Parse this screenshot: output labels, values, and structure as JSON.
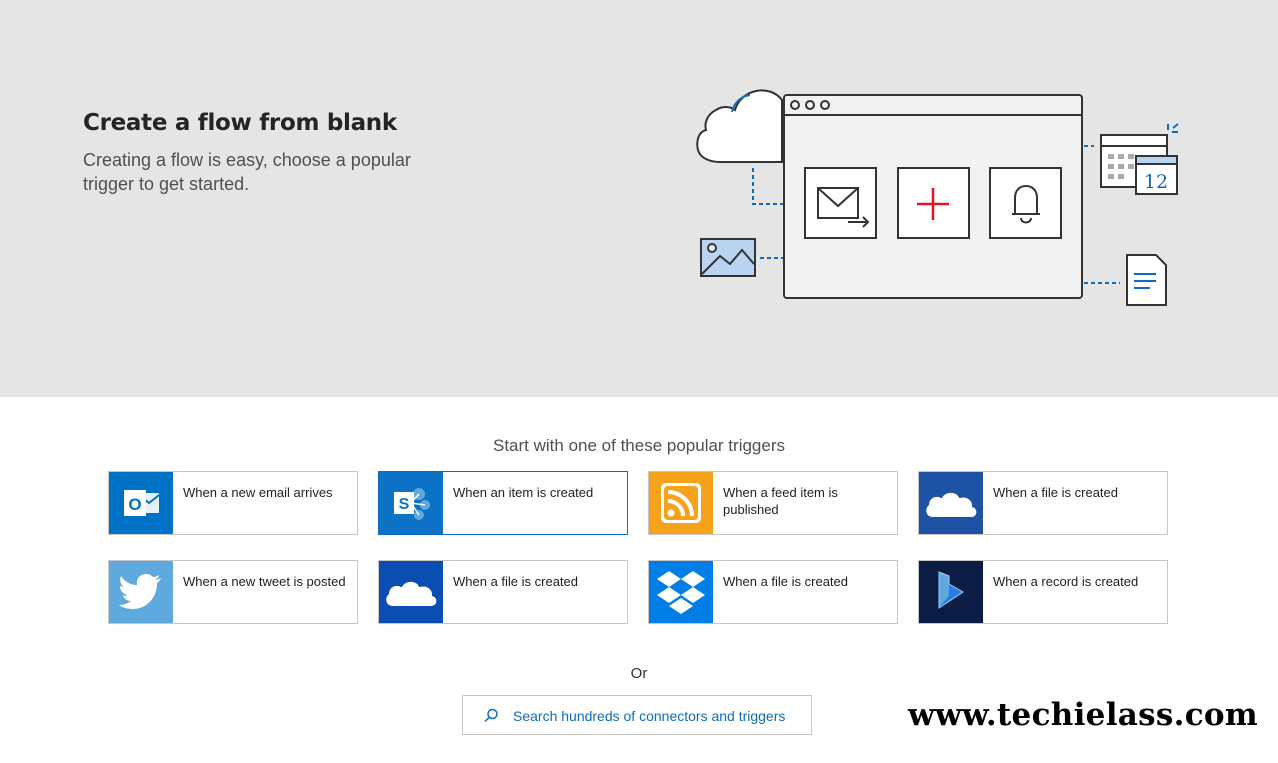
{
  "hero": {
    "title": "Create a flow from blank",
    "subtitle": "Creating a flow is easy, choose a popular trigger to get started.",
    "illustration_calendar_day": "12"
  },
  "triggers": {
    "heading": "Start with one of these popular triggers",
    "cards": [
      {
        "label": "When a new email arrives",
        "connector_icon": "outlook-icon",
        "color": "#0072c6"
      },
      {
        "label": "When an item is created",
        "connector_icon": "sharepoint-icon",
        "color": "#0b72c5"
      },
      {
        "label": "When a feed item is published",
        "connector_icon": "rss-icon",
        "color": "#f7a21b"
      },
      {
        "label": "When a file is created",
        "connector_icon": "onedrive-icon",
        "color": "#1d52a5"
      },
      {
        "label": "When a new tweet is posted",
        "connector_icon": "twitter-icon",
        "color": "#5ea9dd"
      },
      {
        "label": "When a file is created",
        "connector_icon": "onedrive-business-icon",
        "color": "#0a4eb3"
      },
      {
        "label": "When a file is created",
        "connector_icon": "dropbox-icon",
        "color": "#007ee5"
      },
      {
        "label": "When a record is created",
        "connector_icon": "dynamics-icon",
        "color": "#0b1d45"
      }
    ]
  },
  "or_text": "Or",
  "search": {
    "placeholder": "Search hundreds of connectors and triggers"
  },
  "watermark": "www.techielass.com",
  "colors": {
    "accent": "#0f6cbd",
    "hero_background": "#e5e5e5",
    "plus_red": "#e81123"
  }
}
